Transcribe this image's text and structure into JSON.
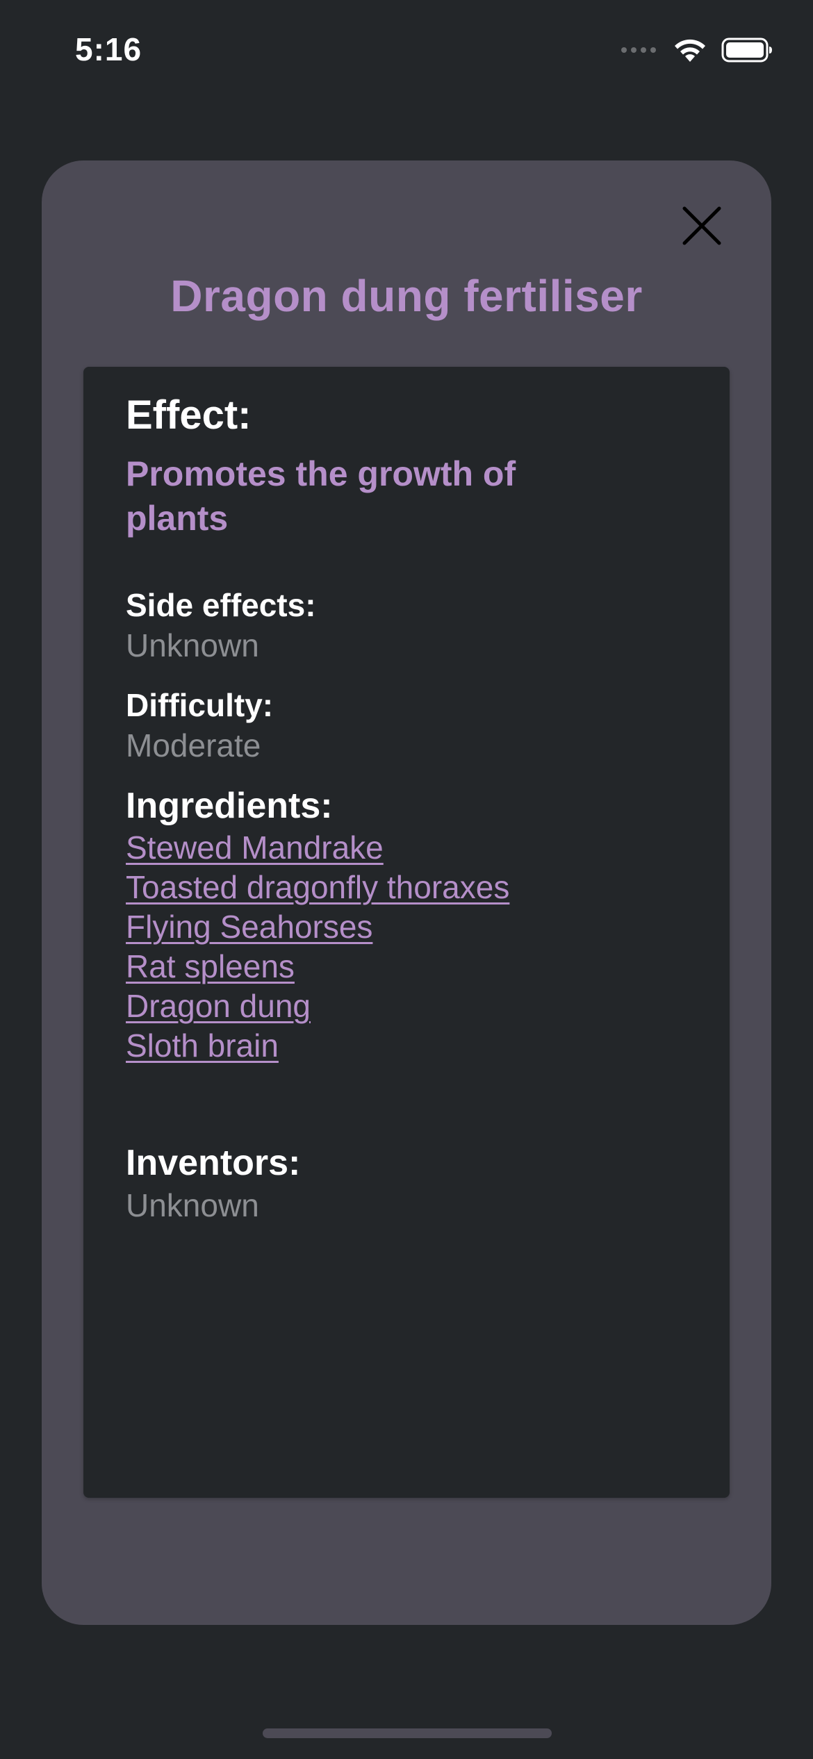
{
  "status_bar": {
    "time": "5:16",
    "icons": [
      "signal-dots-icon",
      "wifi-icon",
      "battery-icon"
    ]
  },
  "modal": {
    "title": "Dragon dung fertiliser",
    "close_icon": "close-icon"
  },
  "details": {
    "effect_label": "Effect:",
    "effect_value": "Promotes the growth of plants",
    "side_effects_label": "Side effects:",
    "side_effects_value": "Unknown",
    "difficulty_label": "Difficulty:",
    "difficulty_value": "Moderate",
    "ingredients_label": "Ingredients:",
    "ingredients": [
      "Stewed Mandrake",
      "Toasted dragonfly thoraxes",
      "Flying Seahorses",
      "Rat spleens",
      "Dragon dung",
      "Sloth brain"
    ],
    "inventors_label": "Inventors:",
    "inventors_value": "Unknown"
  },
  "colors": {
    "background": "#232629",
    "modal": "#4c4a55",
    "accent": "#b58fc9",
    "muted_text": "#8d8f93"
  }
}
